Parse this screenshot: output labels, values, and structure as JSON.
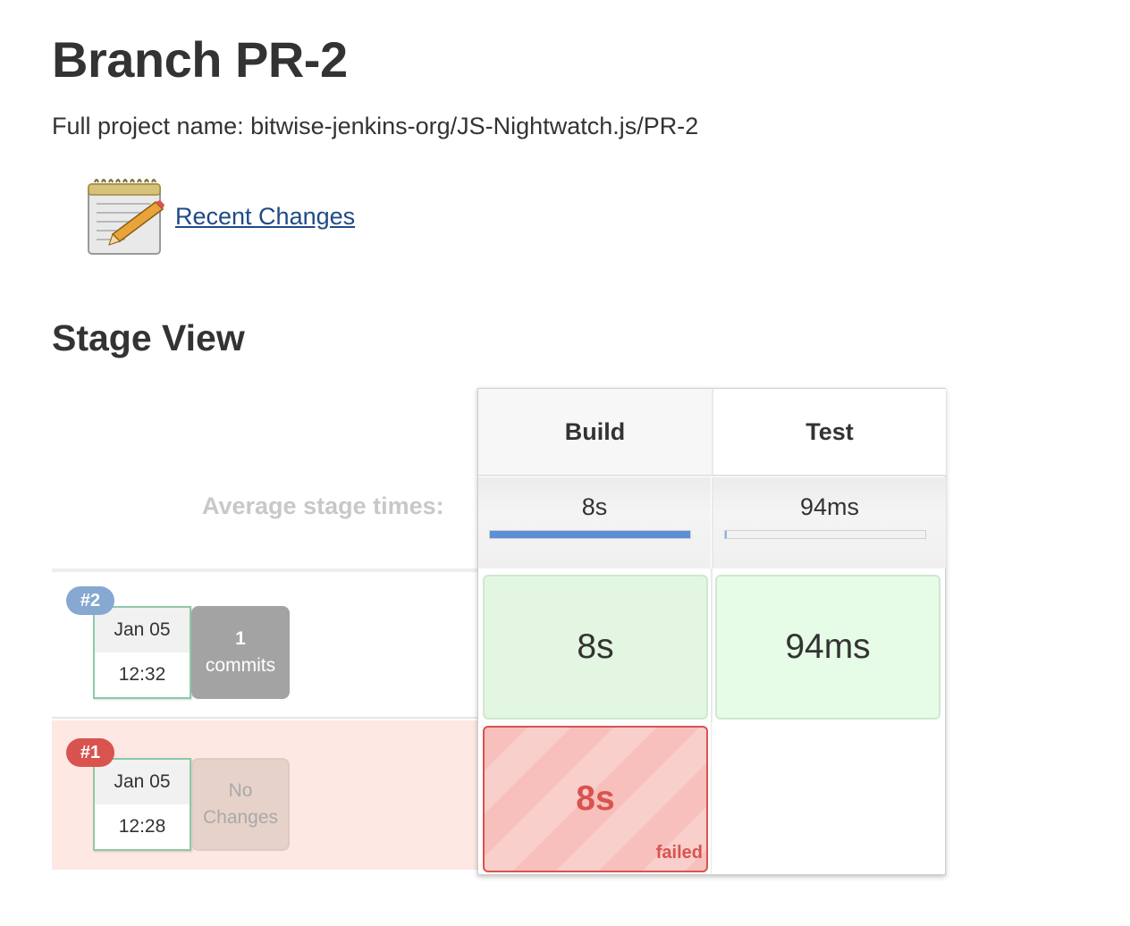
{
  "page": {
    "title": "Branch PR-2",
    "full_project_name": "Full project name: bitwise-jenkins-org/JS-Nightwatch.js/PR-2"
  },
  "recent_changes": {
    "label": "Recent Changes",
    "icon": "notepad-pencil-icon"
  },
  "stage_view": {
    "title": "Stage View",
    "average_label": "Average stage times:",
    "stages": [
      {
        "name": "Build",
        "avg_time": "8s",
        "avg_fraction": 1.0
      },
      {
        "name": "Test",
        "avg_time": "94ms",
        "avg_fraction": 0.01
      }
    ],
    "runs": [
      {
        "number": "#2",
        "status": "success",
        "date": "Jan 05",
        "time": "12:32",
        "commit_count": "1",
        "commit_label": "commits",
        "stage_results": [
          {
            "duration": "8s",
            "status": "success"
          },
          {
            "duration": "94ms",
            "status": "success"
          }
        ]
      },
      {
        "number": "#1",
        "status": "failed",
        "date": "Jan 05",
        "time": "12:28",
        "changes_label_line1": "No",
        "changes_label_line2": "Changes",
        "stage_results": [
          {
            "duration": "8s",
            "status": "failed",
            "status_label": "failed"
          }
        ]
      }
    ]
  },
  "colors": {
    "link": "#204a87",
    "success_cell": "#e2f6e2",
    "failed_border": "#d9534f",
    "failed_row": "#fde8e3",
    "avg_bar": "#5b8fd6"
  }
}
